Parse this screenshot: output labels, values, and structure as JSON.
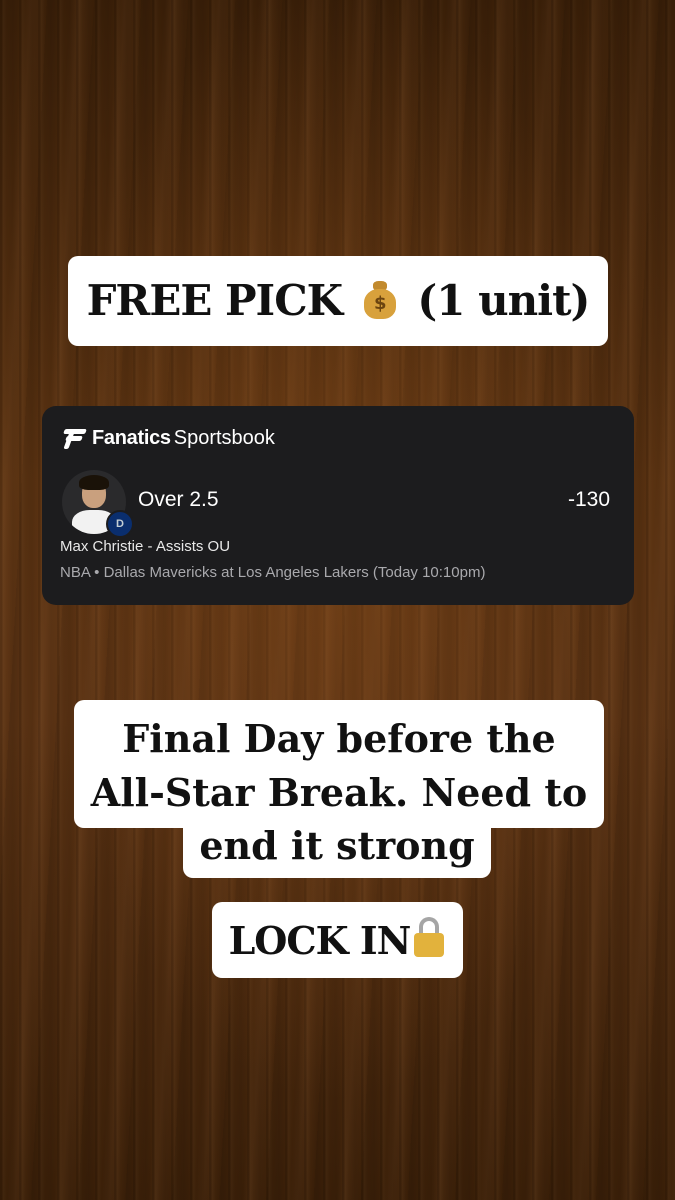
{
  "title_caption": {
    "text_before": "FREE PICK",
    "icon": "money-bag-icon",
    "text_after": "(1 unit)"
  },
  "bet_card": {
    "brand": "Fanatics",
    "brand_suffix": "Sportsbook",
    "selection": "Over 2.5",
    "odds": "-130",
    "market": "Max Christie - Assists OU",
    "event": "NBA • Dallas Mavericks at Los Angeles Lakers (Today 10:10pm)",
    "team_badge_icon": "mavericks-logo-icon"
  },
  "message_caption": {
    "line1": "Final Day before the",
    "line2": "All-Star Break. Need to",
    "line3": "end it strong"
  },
  "lock_caption": {
    "text": "LOCK IN",
    "icon": "lock-icon"
  },
  "colors": {
    "background": "#3c2108",
    "card": "#1c1c1e",
    "caption_bg": "#ffffff"
  }
}
